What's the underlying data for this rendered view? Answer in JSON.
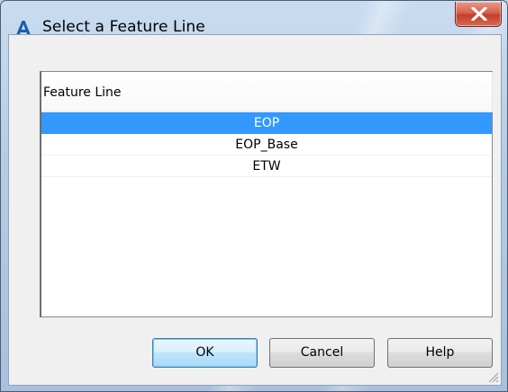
{
  "window": {
    "title": "Select a Feature Line",
    "icon": "autocad-civil3d-icon",
    "close_icon": "close-icon"
  },
  "list": {
    "column_header": "Feature Line",
    "items": [
      {
        "label": "EOP",
        "selected": true
      },
      {
        "label": "EOP_Base",
        "selected": false
      },
      {
        "label": "ETW",
        "selected": false
      }
    ],
    "selection_color": "#3399ff"
  },
  "buttons": {
    "ok": "OK",
    "cancel": "Cancel",
    "help": "Help"
  }
}
